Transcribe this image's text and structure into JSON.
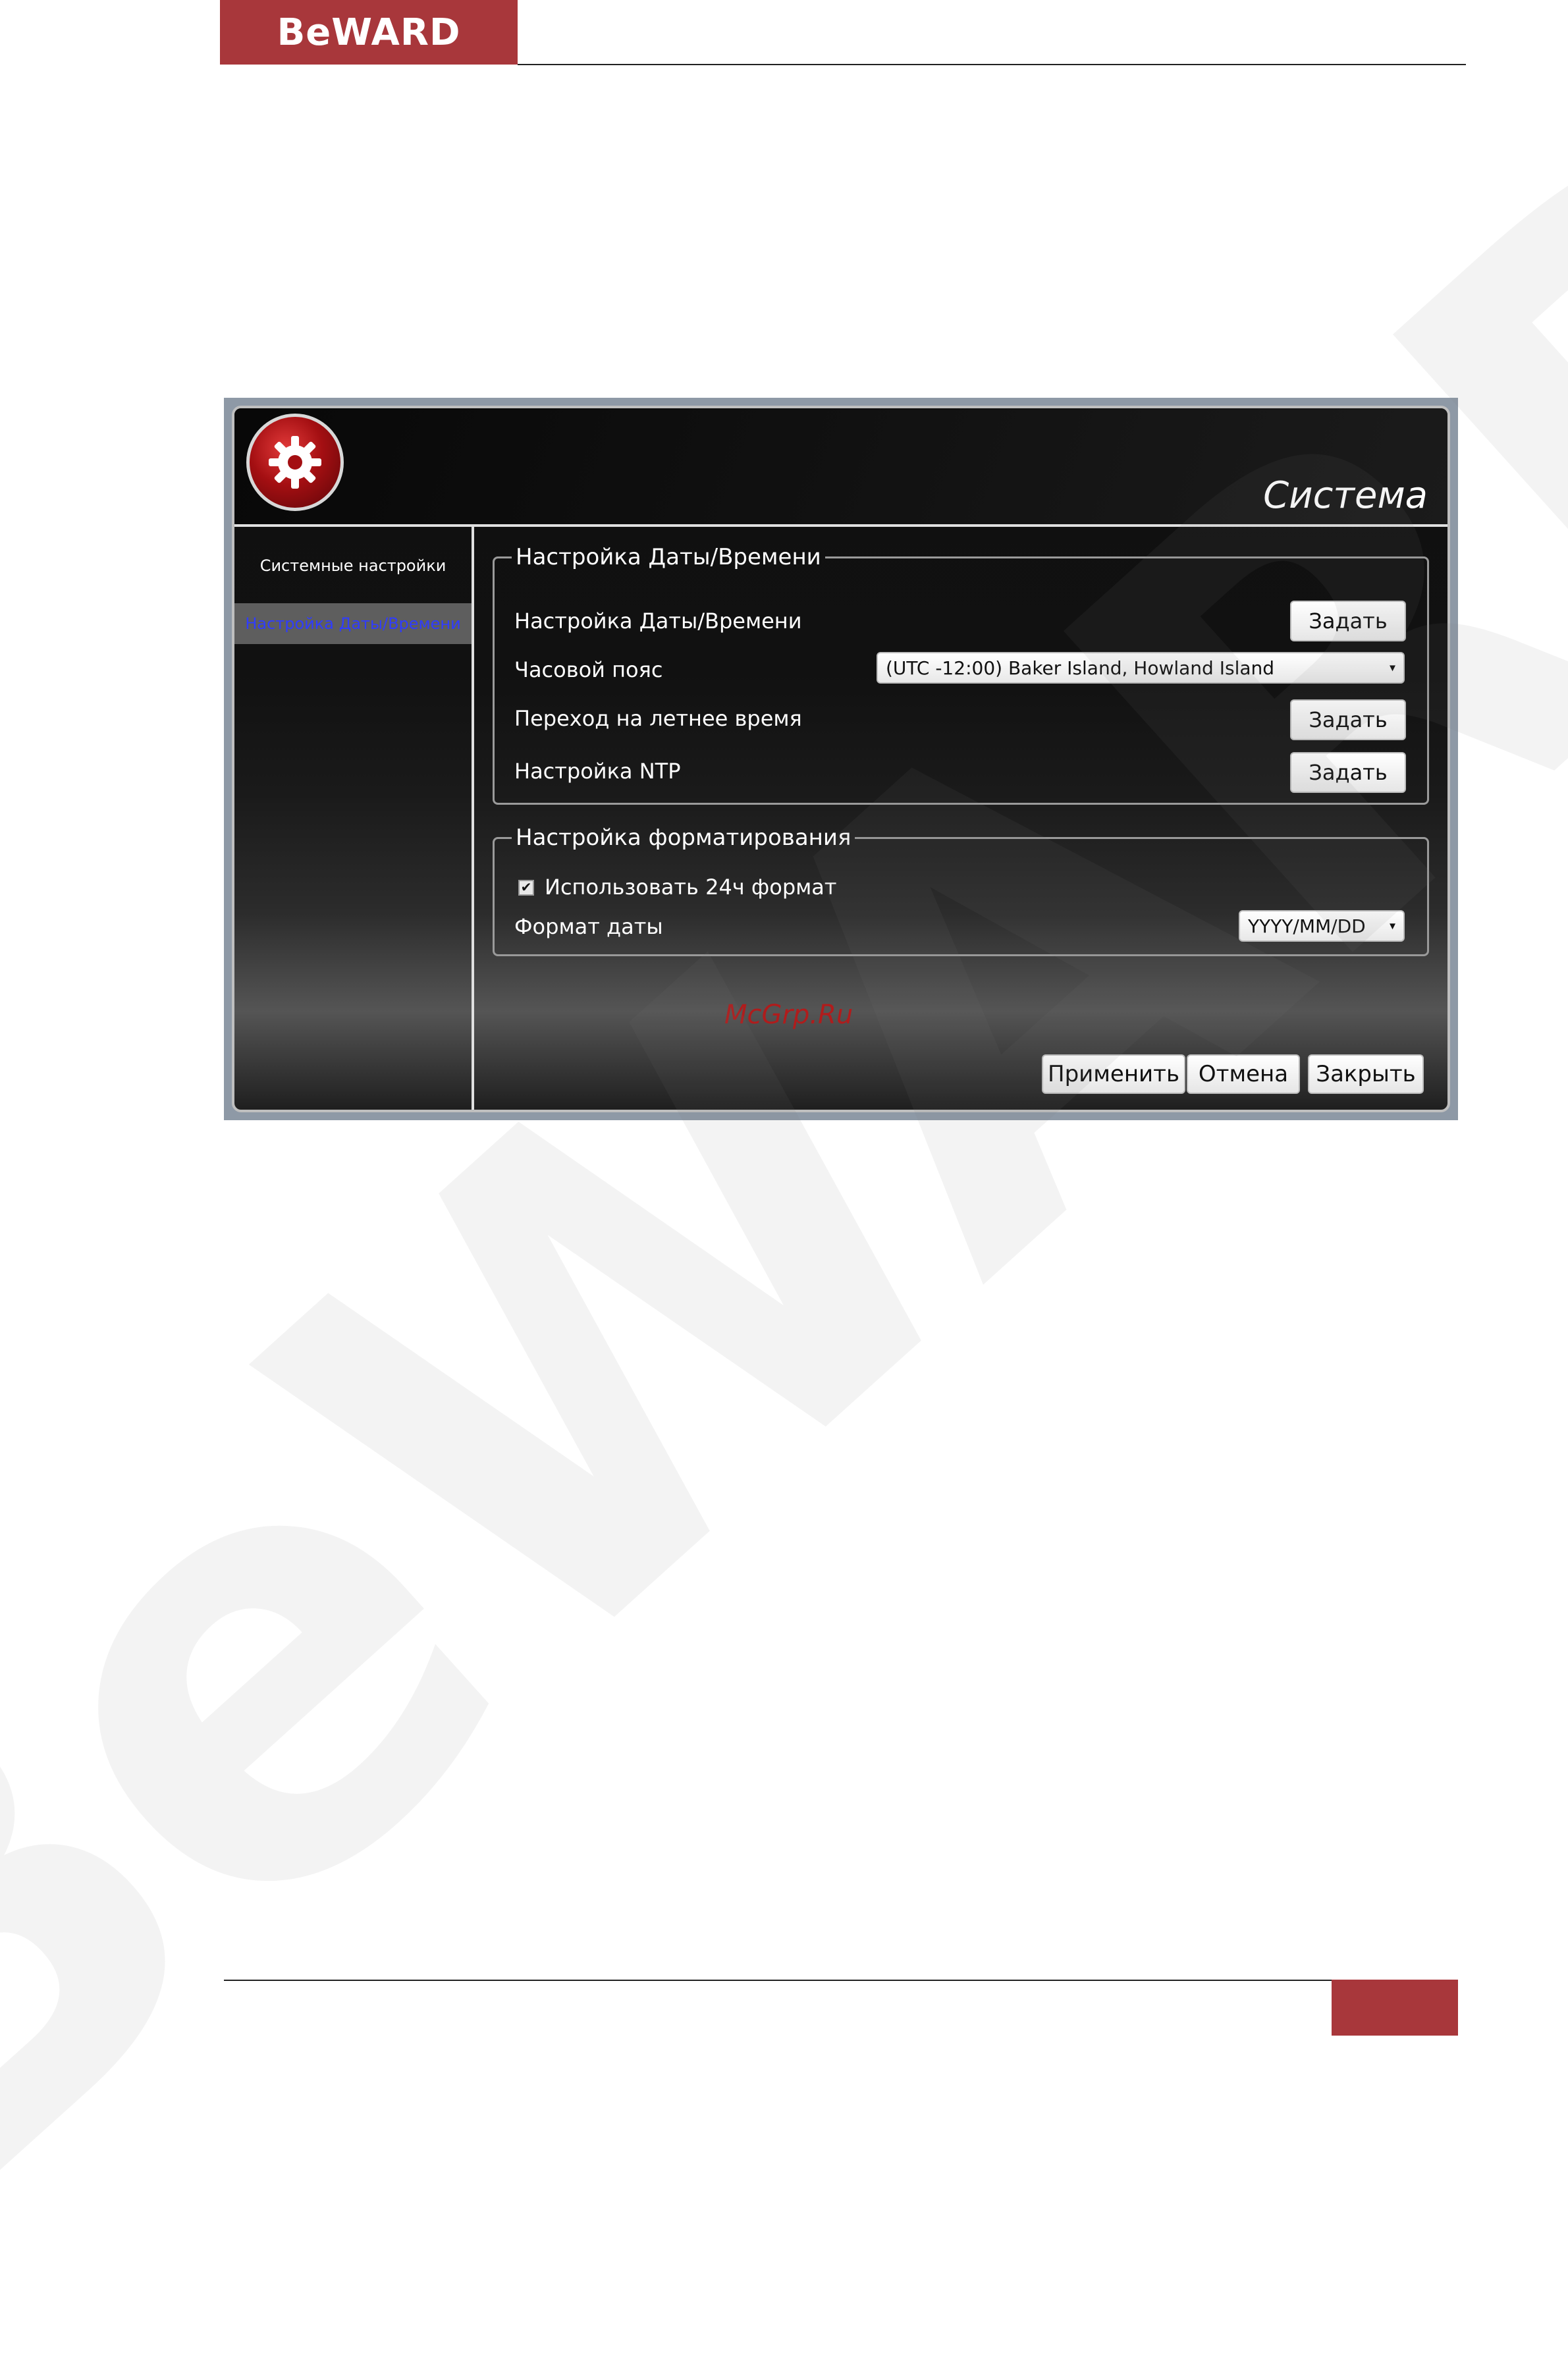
{
  "header": {
    "logo_text": "BeWARD"
  },
  "watermark": {
    "text": "BeWARD"
  },
  "window": {
    "title": "Система",
    "sidebar": {
      "items": [
        {
          "label": "Системные настройки"
        },
        {
          "label": "Настройка Даты/Времени"
        }
      ]
    },
    "datetime_group": {
      "legend": "Настройка Даты/Времени",
      "rows": [
        {
          "label": "Настройка Даты/Времени",
          "button": "Задать"
        },
        {
          "label": "Часовой пояс",
          "select_value": "(UTC -12:00) Baker Island, Howland Island"
        },
        {
          "label": "Переход на летнее время",
          "button": "Задать"
        },
        {
          "label": "Настройка NTP",
          "button": "Задать"
        }
      ]
    },
    "format_group": {
      "legend": "Настройка форматирования",
      "checkbox_label": "Использовать 24ч формат",
      "checkbox_checked": true,
      "date_format_label": "Формат даты",
      "date_format_value": "YYYY/MM/DD"
    },
    "site_mark": "McGrp.Ru",
    "buttons": {
      "apply": "Применить",
      "cancel": "Отмена",
      "close": "Закрыть"
    }
  }
}
